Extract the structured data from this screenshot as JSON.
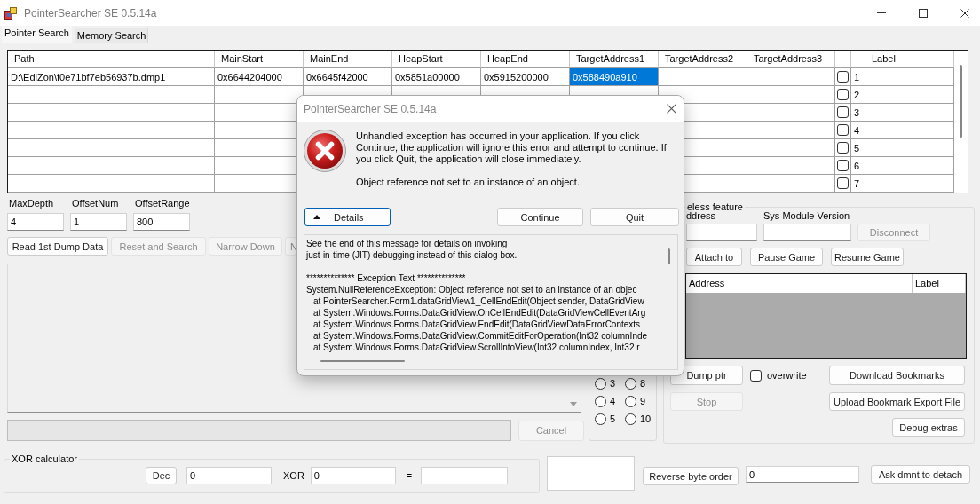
{
  "window": {
    "title": "PointerSearcher SE 0.5.14a"
  },
  "tabs": [
    {
      "label": "Pointer Search",
      "selected": true
    },
    {
      "label": "Memory Search",
      "selected": false
    }
  ],
  "grid": {
    "columns": [
      {
        "kind": "text",
        "label": "Path"
      },
      {
        "kind": "text",
        "label": "MainStart"
      },
      {
        "kind": "text",
        "label": "MainEnd"
      },
      {
        "kind": "text",
        "label": "HeapStart"
      },
      {
        "kind": "text",
        "label": "HeapEnd"
      },
      {
        "kind": "text",
        "label": "TargetAddress1"
      },
      {
        "kind": "text",
        "label": "TargetAddress2"
      },
      {
        "kind": "text",
        "label": "TargetAddress3"
      },
      {
        "kind": "check"
      },
      {
        "kind": "number"
      },
      {
        "kind": "text",
        "label": "Label"
      }
    ],
    "rows": [
      {
        "number": "1",
        "checked": false,
        "cells": [
          {
            "text": "D:\\EdiZon\\f0e71bf7eb56937b.dmp1",
            "selected": false
          },
          {
            "text": "0x6644204000",
            "selected": false
          },
          {
            "text": "0x6645f42000",
            "selected": false
          },
          {
            "text": "0x5851a00000",
            "selected": false
          },
          {
            "text": "0x5915200000",
            "selected": false
          },
          {
            "text": "0x588490a910",
            "selected": true
          },
          {
            "selected": false
          },
          {
            "selected": false
          },
          {
            "selected": false
          }
        ]
      },
      {
        "number": "2",
        "checked": false
      },
      {
        "number": "3",
        "checked": false
      },
      {
        "number": "4",
        "checked": false
      },
      {
        "number": "5",
        "checked": false
      },
      {
        "number": "6",
        "checked": false
      },
      {
        "number": "7",
        "checked": false
      }
    ]
  },
  "search_params": [
    {
      "label": "MaxDepth",
      "value": "4"
    },
    {
      "label": "OffsetNum",
      "value": "1"
    },
    {
      "label": "OffsetRange",
      "value": "800"
    }
  ],
  "actions": [
    {
      "label": "Read 1st Dump Data",
      "disabled": false
    },
    {
      "label": "Reset and Search",
      "disabled": true
    },
    {
      "label": "Narrow Down",
      "disabled": true
    },
    {
      "label": "N",
      "disabled": true
    }
  ],
  "progress": {
    "level": 0
  },
  "cancel": {
    "label": "Cancel",
    "disabled": true
  },
  "radios": [
    {
      "label": "3",
      "selected": false
    },
    {
      "label": "8",
      "selected": false
    },
    {
      "label": "4",
      "selected": false
    },
    {
      "label": "9",
      "selected": false
    },
    {
      "label": "5",
      "selected": false
    },
    {
      "label": "10",
      "selected": false
    }
  ],
  "connection": {
    "title": "eless feature",
    "address_label": "ddress",
    "module_label": "Sys Module Version",
    "disconnect": {
      "label": "Disconnect",
      "disabled": true
    },
    "controls": [
      {
        "label": "Attach to",
        "disabled": false
      },
      {
        "label": "Pause Game",
        "disabled": false
      },
      {
        "label": "Resume Game",
        "disabled": false
      }
    ],
    "bookmarks": {
      "columns": [
        "Address",
        "Label"
      ]
    },
    "dump": {
      "label": "Dump ptr",
      "disabled": false
    },
    "overwrite": {
      "label": "overwrite",
      "checked": false
    },
    "stop": {
      "label": "Stop",
      "disabled": true
    },
    "bookmark_buttons": [
      "Download Bookmarks",
      "Upload Bookmark Export File",
      "Debug extras"
    ]
  },
  "xor": {
    "title": "XOR calculator",
    "base_button": "Dec",
    "left_value": "0",
    "operator": "XOR",
    "right_value": "0",
    "equals": "="
  },
  "converter": {
    "reverse_button": "Reverse byte order",
    "value": "0",
    "detach_button": "Ask dmnt to detach"
  },
  "dialog": {
    "title": "PointerSearcher SE 0.5.14a",
    "message": "Unhandled exception has occurred in your application. If you click Continue, the application will ignore this error and attempt to continue. If you click Quit, the application will close immediately.",
    "detail": "Object reference not set to an instance of an object.",
    "details_button": {
      "label": "Details",
      "expanded": true
    },
    "buttons": [
      "Continue",
      "Quit"
    ],
    "details_lines": [
      {
        "kind": "text",
        "text": "See the end of this message for details on invoking"
      },
      {
        "kind": "text",
        "text": "just-in-time (JIT) debugging instead of this dialog box."
      },
      {
        "kind": "heading",
        "text": "************** Exception Text **************"
      },
      {
        "kind": "text",
        "text": "System.NullReferenceException: Object reference not set to an instance of an objec"
      },
      {
        "kind": "frame",
        "text": "at PointerSearcher.Form1.dataGridView1_CellEndEdit(Object sender, DataGridView"
      },
      {
        "kind": "frame",
        "text": "at System.Windows.Forms.DataGridView.OnCellEndEdit(DataGridViewCellEventArg"
      },
      {
        "kind": "frame",
        "text": "at System.Windows.Forms.DataGridView.EndEdit(DataGridViewDataErrorContexts"
      },
      {
        "kind": "frame",
        "text": "at System.Windows.Forms.DataGridView.CommitEditForOperation(Int32 columnInde"
      },
      {
        "kind": "frame",
        "text": "at System.Windows.Forms.DataGridView.ScrollIntoView(Int32 columnIndex, Int32 r"
      }
    ]
  }
}
